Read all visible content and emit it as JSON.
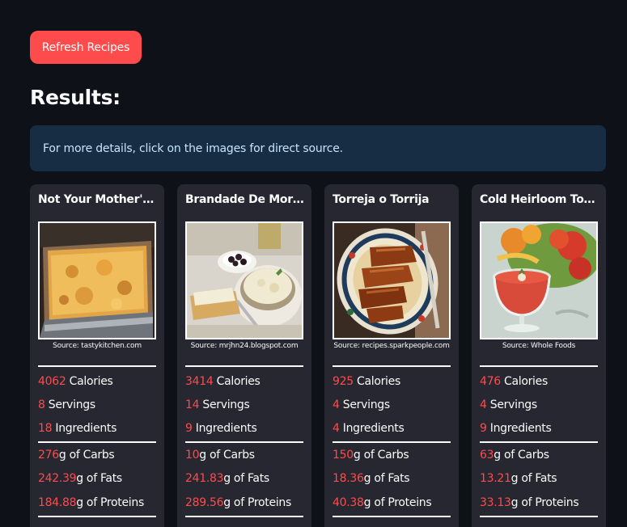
{
  "refresh_button": {
    "label": "Refresh Recipes"
  },
  "results_heading": "Results:",
  "info_message": "For more details, click on the images for direct source.",
  "recipes": [
    {
      "title": "Not Your Mother's Mac and Cheese",
      "source": "Source: tastykitchen.com",
      "calories": "4062",
      "calories_label": "Calories",
      "servings": "8",
      "servings_label": "Servings",
      "ingredients": "18",
      "ingredients_label": "Ingredients",
      "carbs": "276",
      "carbs_label": "g of Carbs",
      "fats": "242.39",
      "fats_label": "g of Fats",
      "proteins": "184.88",
      "proteins_label": "g of Proteins"
    },
    {
      "title": "Brandade De Morue",
      "source": "Source: mrjhn24.blogspot.com",
      "calories": "3414",
      "calories_label": "Calories",
      "servings": "14",
      "servings_label": "Servings",
      "ingredients": "9",
      "ingredients_label": "Ingredients",
      "carbs": "10",
      "carbs_label": "g of Carbs",
      "fats": "241.83",
      "fats_label": "g of Fats",
      "proteins": "289.56",
      "proteins_label": "g of Proteins"
    },
    {
      "title": "Torreja o Torrija",
      "source": "Source: recipes.sparkpeople.com",
      "calories": "925",
      "calories_label": "Calories",
      "servings": "4",
      "servings_label": "Servings",
      "ingredients": "4",
      "ingredients_label": "Ingredients",
      "carbs": "150",
      "carbs_label": "g of Carbs",
      "fats": "18.36",
      "fats_label": "g of Fats",
      "proteins": "40.38",
      "proteins_label": "g of Proteins"
    },
    {
      "title": "Cold Heirloom Tomato Soup",
      "source": "Source: Whole Foods",
      "calories": "476",
      "calories_label": "Calories",
      "servings": "4",
      "servings_label": "Servings",
      "ingredients": "9",
      "ingredients_label": "Ingredients",
      "carbs": "63",
      "carbs_label": "g of Carbs",
      "fats": "13.21",
      "fats_label": "g of Fats",
      "proteins": "33.13",
      "proteins_label": "g of Proteins"
    }
  ],
  "colors": {
    "background": "#0e1117",
    "accent": "#ff4b4b",
    "card": "#262730",
    "info_bg": "#172d43",
    "info_text": "#c7e3fb"
  }
}
